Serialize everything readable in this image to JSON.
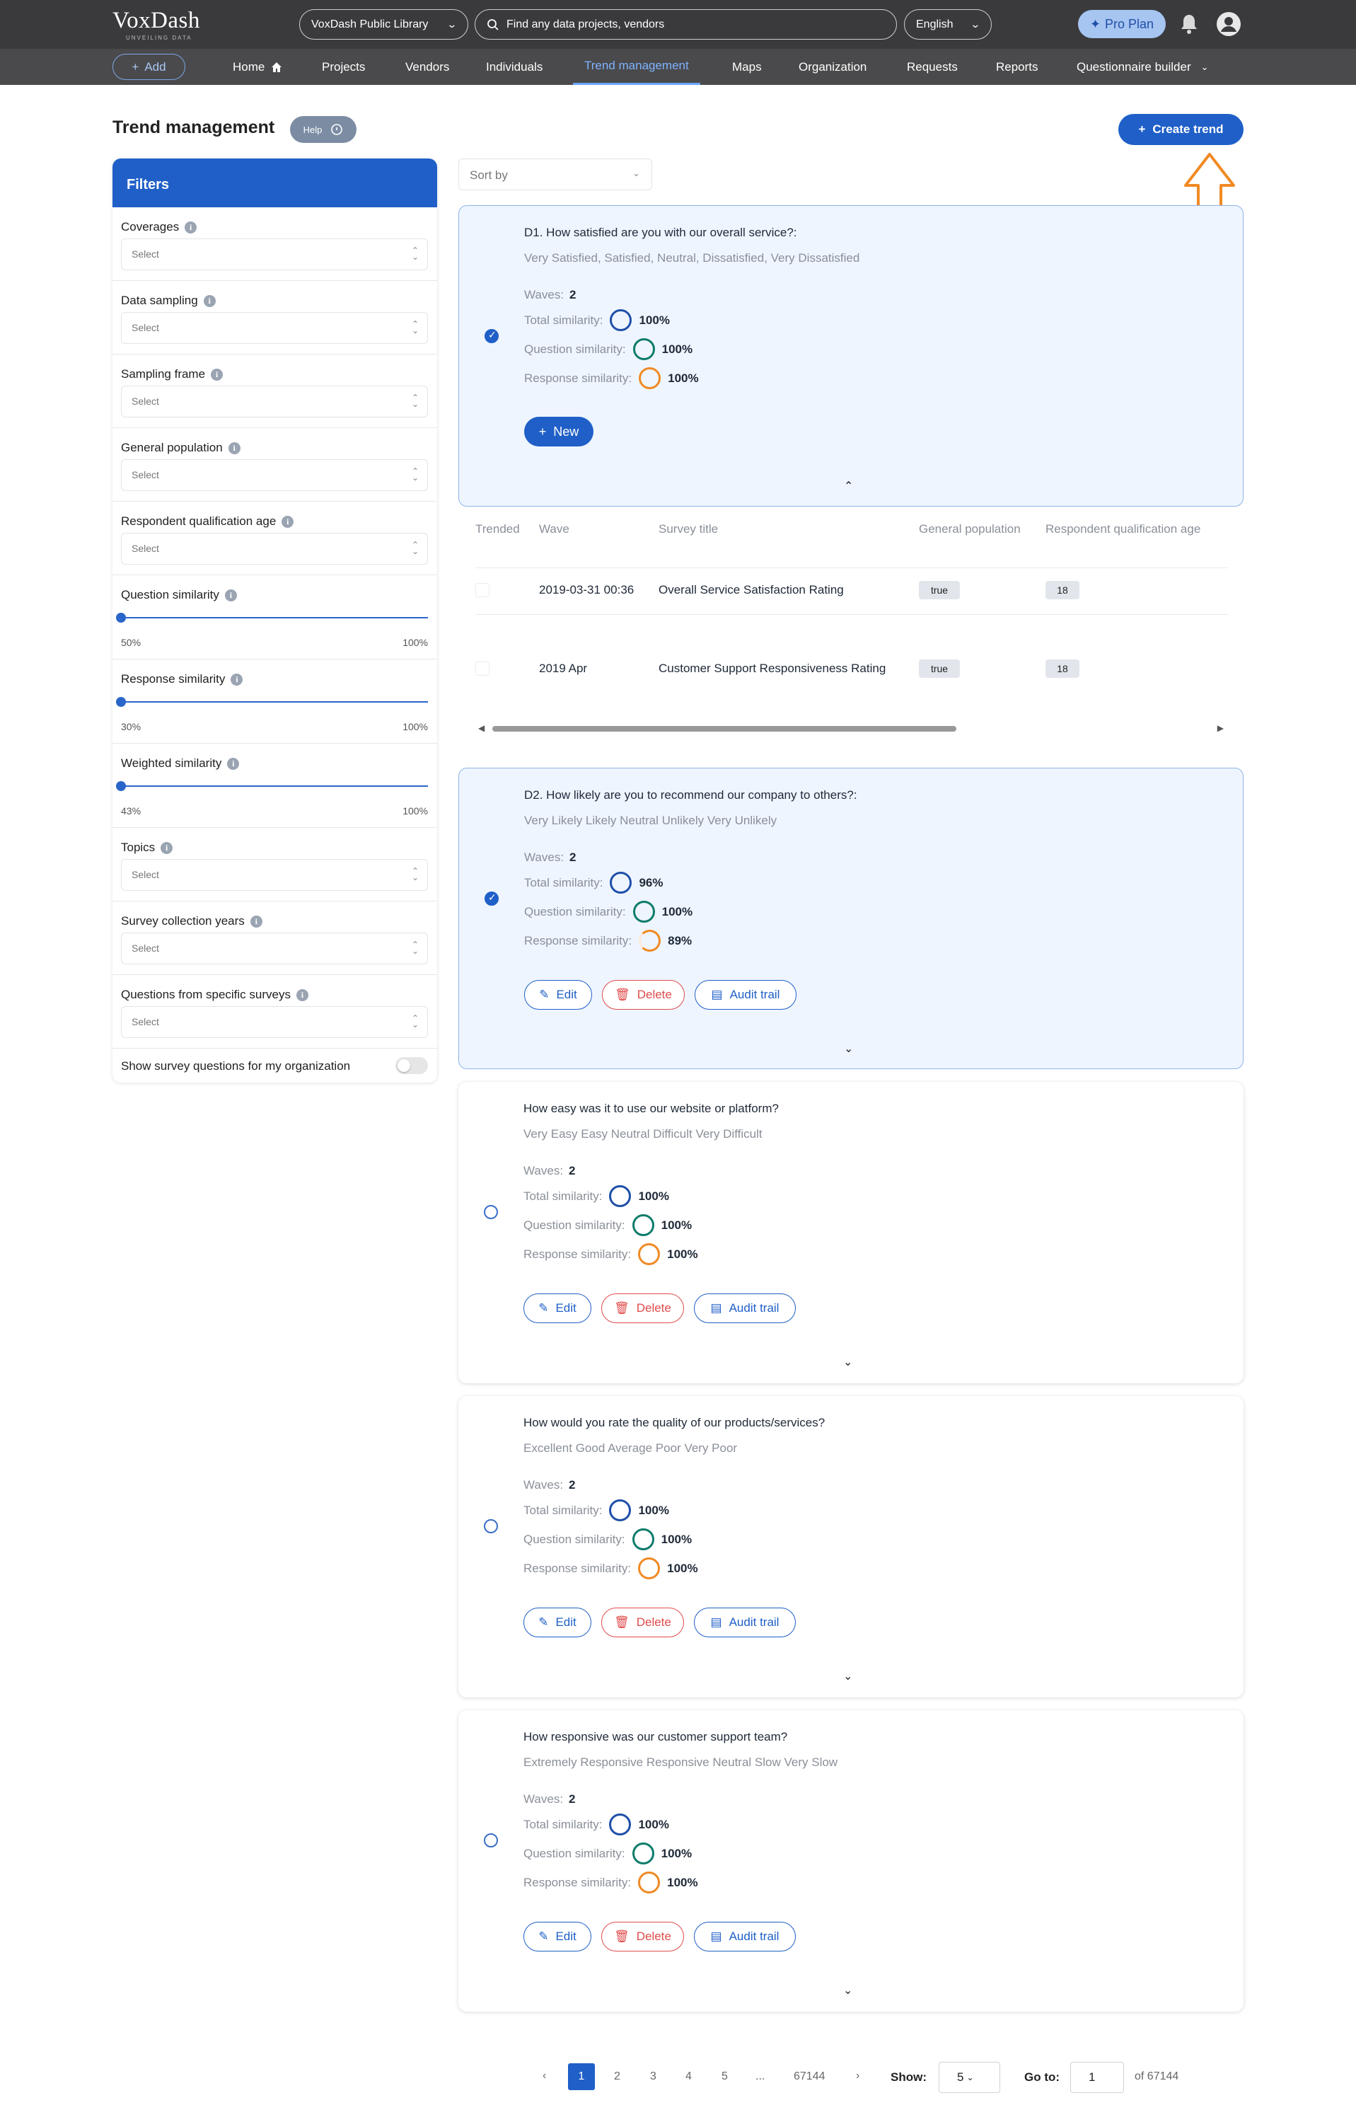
{
  "header": {
    "logo": "VoxDash",
    "logo_sub": "UNVEILING DATA",
    "library_select": "VoxDash Public Library",
    "search_placeholder": "Find any data projects, vendors",
    "language": "English",
    "plan": "Pro Plan"
  },
  "nav": {
    "add_label": "Add",
    "items": [
      "Home",
      "Projects",
      "Vendors",
      "Individuals",
      "Trend management",
      "Maps",
      "Organization",
      "Requests",
      "Reports",
      "Questionnaire builder"
    ],
    "active": "Trend management"
  },
  "page": {
    "title": "Trend management",
    "help_label": "Help",
    "create_label": "Create trend"
  },
  "filters": {
    "title": "Filters",
    "select_placeholder": "Select",
    "coverages": "Coverages",
    "data_sampling": "Data sampling",
    "sampling_frame": "Sampling frame",
    "general_population": "General population",
    "respondent_age": "Respondent qualification age",
    "question_similarity": {
      "label": "Question similarity",
      "min": "50%",
      "max": "100%"
    },
    "response_similarity": {
      "label": "Response similarity",
      "min": "30%",
      "max": "100%"
    },
    "weighted_similarity": {
      "label": "Weighted similarity",
      "min": "43%",
      "max": "100%"
    },
    "topics": "Topics",
    "survey_years": "Survey collection years",
    "specific_surveys": "Questions from specific surveys",
    "show_org": "Show survey questions for my organization"
  },
  "sort_label": "Sort by",
  "labels": {
    "waves": "Waves:",
    "total": "Total similarity:",
    "question": "Question similarity:",
    "response": "Response similarity:",
    "new": "New",
    "edit": "Edit",
    "delete": "Delete",
    "audit": "Audit trail"
  },
  "cards": [
    {
      "question": "D1. How satisfied are you with our overall service?:",
      "options": "Very Satisfied, Satisfied, Neutral, Dissatisfied, Very Dissatisfied",
      "waves": "2",
      "total": "100%",
      "qsim": "100%",
      "rsim": "100%"
    },
    {
      "question": "D2. How likely are you to recommend our company to others?:",
      "options": "Very Likely Likely Neutral Unlikely Very Unlikely",
      "waves": "2",
      "total": "96%",
      "qsim": "100%",
      "rsim": "89%"
    },
    {
      "question": "How easy was it to use our website or platform?",
      "options": "Very Easy Easy Neutral Difficult Very Difficult",
      "waves": "2",
      "total": "100%",
      "qsim": "100%",
      "rsim": "100%"
    },
    {
      "question": "How would you rate the quality of our products/services?",
      "options": "Excellent Good Average Poor Very Poor",
      "waves": "2",
      "total": "100%",
      "qsim": "100%",
      "rsim": "100%"
    },
    {
      "question": "How responsive was our customer support team?",
      "options": "Extremely Responsive Responsive Neutral Slow Very Slow",
      "waves": "2",
      "total": "100%",
      "qsim": "100%",
      "rsim": "100%"
    }
  ],
  "wave_table": {
    "headers": [
      "Trended",
      "Wave",
      "Survey title",
      "General population",
      "Respondent qualification age"
    ],
    "rows": [
      {
        "wave": "2019-03-31 00:36",
        "title": "Overall Service Satisfaction Rating",
        "gp": "true",
        "age": "18"
      },
      {
        "wave": "2019 Apr",
        "title": "Customer Support Responsiveness Rating",
        "gp": "true",
        "age": "18"
      }
    ]
  },
  "pagination": {
    "prev": "‹",
    "pages": [
      "1",
      "2",
      "3",
      "4",
      "5",
      "...",
      "67144"
    ],
    "next": "›",
    "show_label": "Show:",
    "show_value": "5",
    "goto_label": "Go to:",
    "goto_value": "1",
    "of_label": "of 67144"
  },
  "colors": {
    "primary": "#1f5fc7",
    "annotation_arrow": "#f08a24"
  }
}
